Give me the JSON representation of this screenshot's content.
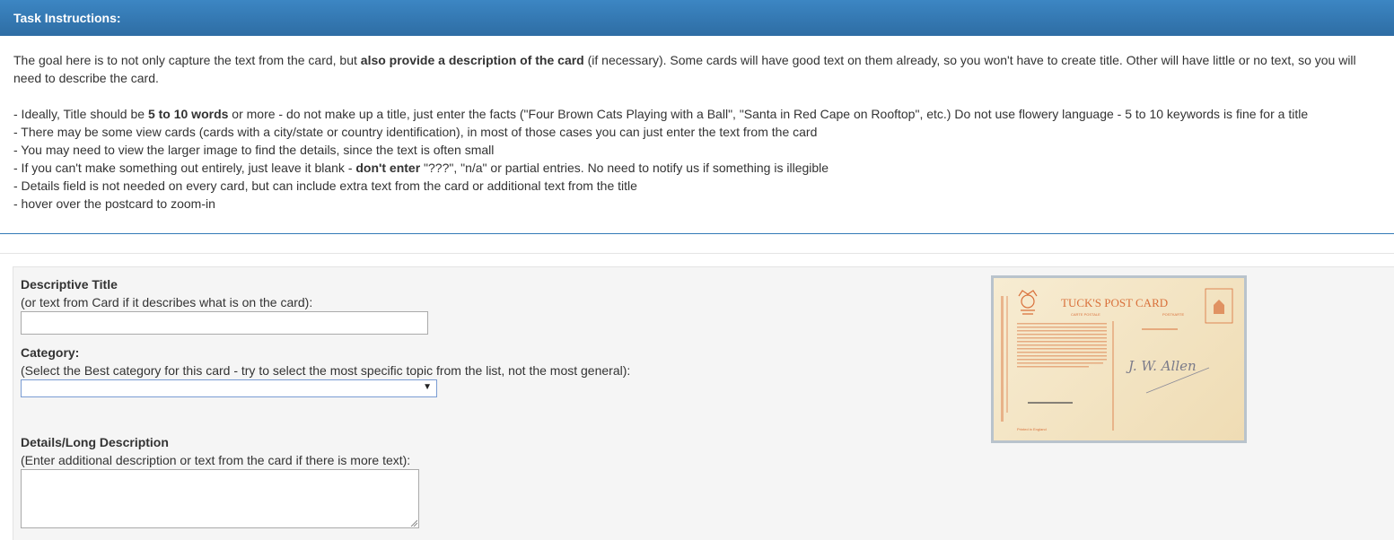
{
  "instructions": {
    "heading": "Task Instructions:",
    "intro_a": "The goal here is to not only capture the text from the card, but ",
    "intro_b": "also provide a description of the card",
    "intro_c": " (if necessary). Some cards will have good text on them already, so you won't have to create title. Other will have little or no text, so you will",
    "intro_d": "need to describe the card.",
    "b1_a": "- Ideally, Title should be ",
    "b1_b": "5 to 10 words",
    "b1_c": " or more - do not make up a title, just enter the facts (\"Four Brown Cats Playing with a Ball\", \"Santa in Red Cape on Rooftop\", etc.) Do not use flowery language - 5 to 10 keywords is fine for a title",
    "b2": "- There may be some view cards (cards with a city/state or country identification), in most of those cases you can just enter the text from the card",
    "b3": "- You may need to view the larger image to find the details, since the text is often small",
    "b4_a": "- If you can't make something out entirely, just leave it blank - ",
    "b4_b": "don't enter",
    "b4_c": " \"???\", \"n/a\" or partial entries. No need to notify us if something is illegible",
    "b5": "- Details field is not needed on every card, but can include extra text from the card or additional text from the title",
    "b6": "- hover over the postcard to zoom-in"
  },
  "form": {
    "title_label": "Descriptive Title",
    "title_help": "(or text from Card if it describes what is on the card):",
    "title_value": "",
    "category_label": "Category:",
    "category_help": "(Select the Best category for this card - try to select the most specific topic from the list, not the most general):",
    "category_value": "",
    "details_label": "Details/Long Description",
    "details_help": "(Enter additional description or text from the card if there is more text):",
    "details_value": ""
  },
  "postcard": {
    "header": "TUCK'S POST CARD",
    "carte_postale": "CARTE POSTALE",
    "postkarte": "POSTKARTE",
    "signature": "J. W. Allen",
    "printed": "Printed in England",
    "ink_color": "#d9703a"
  },
  "colors": {
    "heading_bg": "#337ab7",
    "panel_border": "#337ab7"
  }
}
